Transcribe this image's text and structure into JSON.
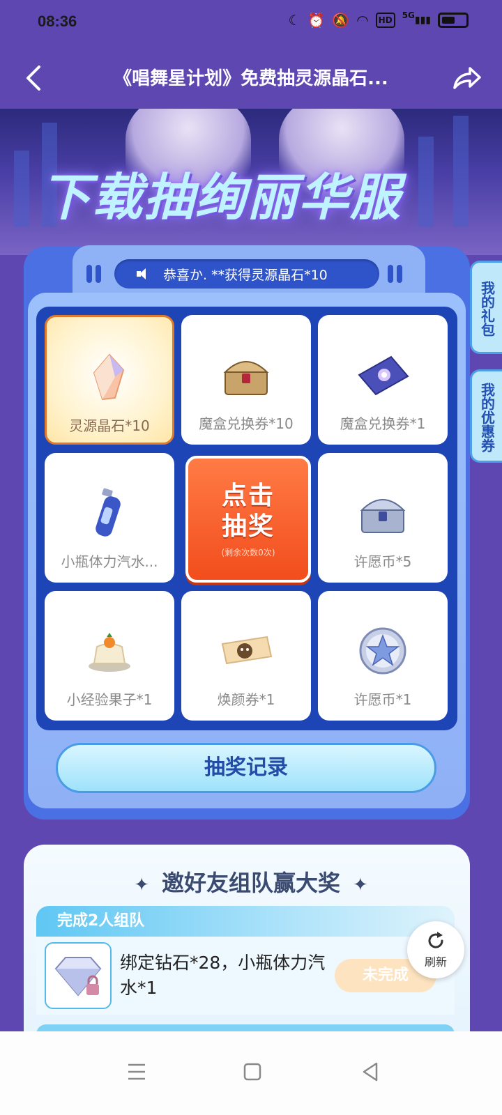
{
  "status_bar": {
    "time": "08:36",
    "network": "5G",
    "hd": "HD"
  },
  "header": {
    "title": "《唱舞星计划》免费抽灵源晶石...",
    "back_icon": "back-arrow-icon",
    "share_icon": "share-icon"
  },
  "banner": {
    "title": "下载抽绚丽华服"
  },
  "ticker": {
    "text": "恭喜か. **获得灵源晶石*10"
  },
  "side_tabs": {
    "gift": "我的礼包",
    "coupon": "我的优惠券"
  },
  "prizes": [
    {
      "label": "灵源晶石*10",
      "icon": "crystal-icon",
      "active": true
    },
    {
      "label": "魔盒兑换券*10",
      "icon": "gold-chest-icon",
      "active": false
    },
    {
      "label": "魔盒兑换券*1",
      "icon": "ticket-card-icon",
      "active": false
    },
    {
      "label": "小瓶体力汽水...",
      "icon": "soda-bottle-icon",
      "active": false
    },
    {
      "label": "许愿币*5",
      "icon": "silver-chest-icon",
      "active": false
    },
    {
      "label": "小经验果子*1",
      "icon": "pudding-icon",
      "active": false
    },
    {
      "label": "焕颜券*1",
      "icon": "face-ticket-icon",
      "active": false
    },
    {
      "label": "许愿币*1",
      "icon": "star-coin-icon",
      "active": false
    }
  ],
  "draw_button": {
    "label": "点击抽奖",
    "remaining": "(剩余次数0次)"
  },
  "record_button": {
    "label": "抽奖记录"
  },
  "team": {
    "title": "邀好友组队赢大奖",
    "task_header": "完成2人组队",
    "task_reward": "绑定钻石*28，小瓶体力汽水*1",
    "task_status": "未完成",
    "refresh_label": "刷新"
  },
  "colors": {
    "page_bg": "#5f47b1",
    "panel_blue": "#4a70e3",
    "draw_orange": "#f24d1d",
    "tab_cyan": "#bfe9fb"
  }
}
